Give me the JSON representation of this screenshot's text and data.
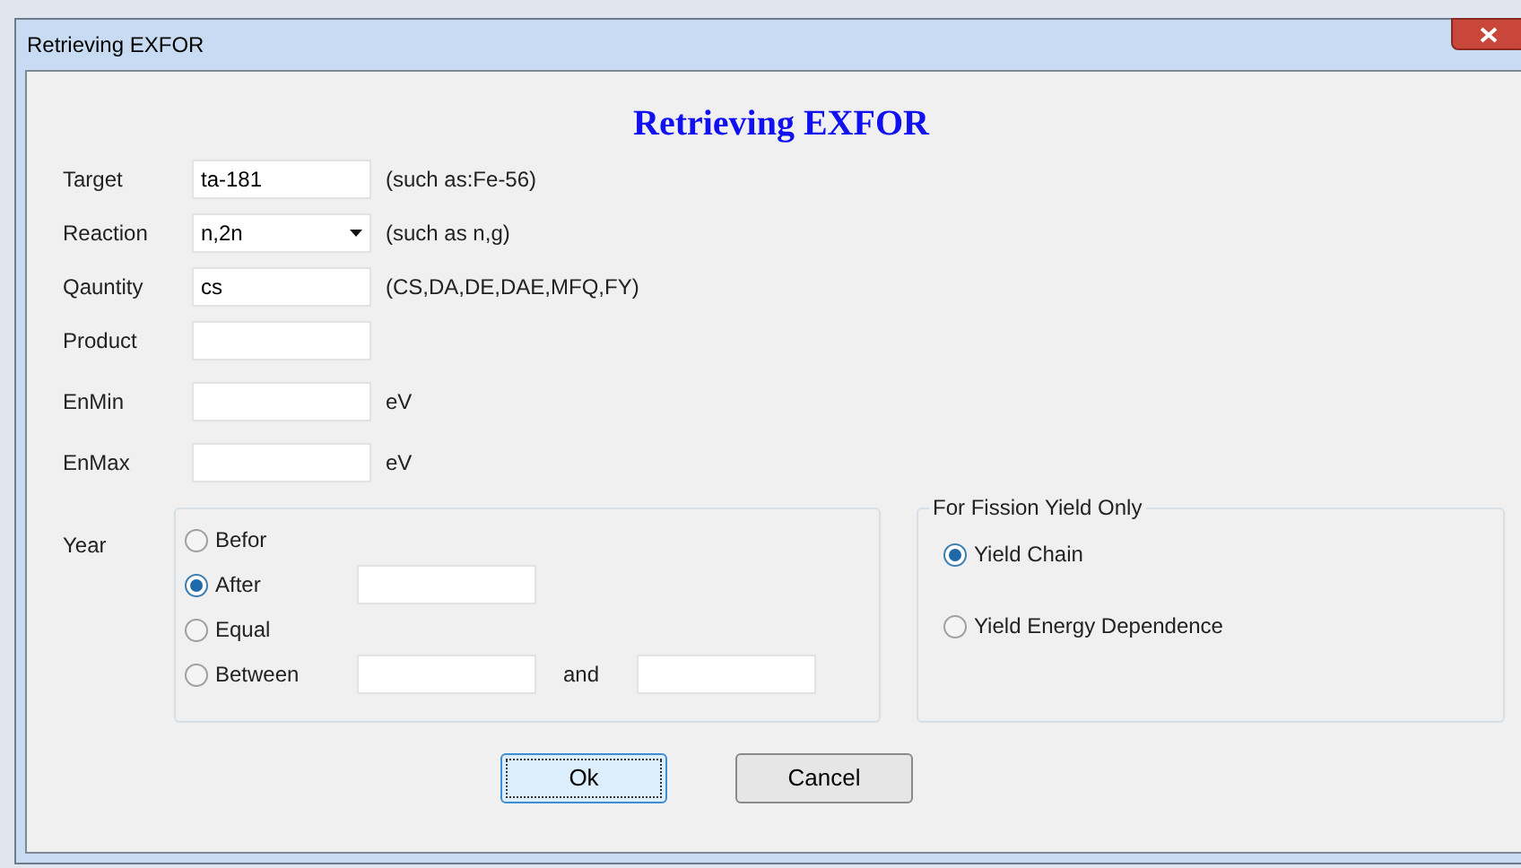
{
  "window": {
    "title": "Retrieving EXFOR"
  },
  "heading": "Retrieving EXFOR",
  "fields": [
    {
      "kind": "text",
      "label": "Target",
      "value": "ta-181",
      "hint": "(such as:Fe-56)"
    },
    {
      "kind": "dropdown",
      "label": "Reaction",
      "value": "n,2n",
      "hint": "(such as n,g)"
    },
    {
      "kind": "text",
      "label": "Qauntity",
      "value": "cs",
      "hint": "(CS,DA,DE,DAE,MFQ,FY)"
    },
    {
      "kind": "text",
      "label": "Product"
    },
    {
      "kind": "text",
      "label": "EnMin",
      "hint": "eV"
    },
    {
      "kind": "text",
      "label": "EnMax",
      "hint": "eV"
    }
  ],
  "year": {
    "label": "Year",
    "options": [
      {
        "kind": "plain",
        "label": "Befor",
        "selected": false
      },
      {
        "kind": "single",
        "label": "After",
        "selected": true
      },
      {
        "kind": "plain",
        "label": "Equal",
        "selected": false
      },
      {
        "kind": "range",
        "label": "Between",
        "selected": false,
        "connector": "and"
      }
    ]
  },
  "fission": {
    "title": "For Fission Yield Only",
    "options": [
      {
        "label": "Yield Chain",
        "selected": true
      },
      {
        "label": "Yield Energy Dependence",
        "selected": false
      }
    ]
  },
  "buttons": [
    {
      "label": "Ok",
      "focused": true
    },
    {
      "label": "Cancel",
      "focused": false
    }
  ]
}
